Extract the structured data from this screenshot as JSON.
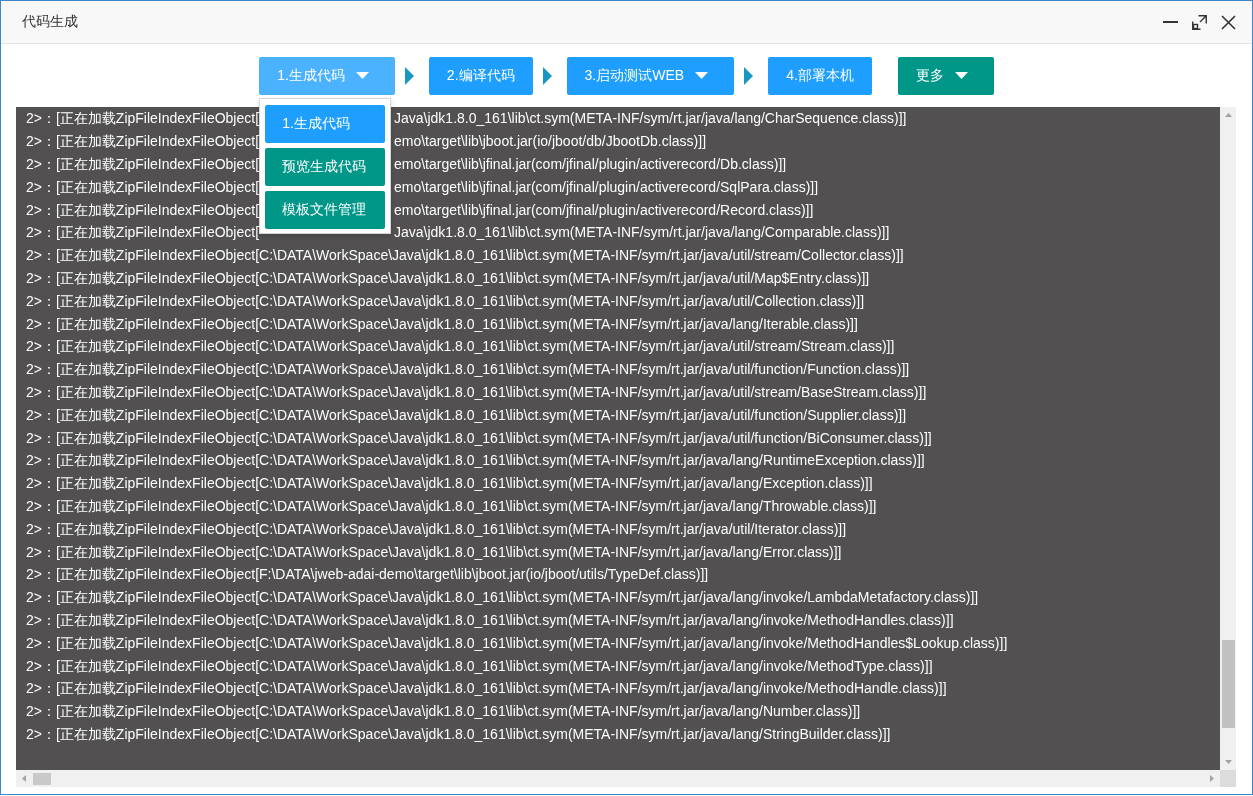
{
  "window": {
    "title": "代码生成"
  },
  "toolbar": [
    {
      "kind": "step",
      "label": "1.生成代码",
      "dropdown": true,
      "expanded": true,
      "menu": [
        {
          "label": "1.生成代码",
          "color": "#1e9fff"
        },
        {
          "label": "预览生成代码",
          "color": "#009688"
        },
        {
          "label": "模板文件管理",
          "color": "#009688"
        }
      ]
    },
    {
      "kind": "step",
      "label": "2.编译代码",
      "dropdown": false,
      "expanded": false
    },
    {
      "kind": "step",
      "label": "3.启动测试WEB",
      "dropdown": true,
      "expanded": false
    },
    {
      "kind": "step",
      "label": "4.部署本机",
      "dropdown": false,
      "expanded": false
    },
    {
      "kind": "more",
      "label": "更多",
      "dropdown": true,
      "expanded": false
    }
  ],
  "log": {
    "lines": [
      {
        "parts": [
          "2>：[正在加载ZipFileIndexFileObject[",
          "Java\\jdk1.8.0_161\\lib\\ct.sym(META-INF/sym/rt.jar/java/lang/CharSequence.class)]]"
        ]
      },
      {
        "parts": [
          "2>：[正在加载ZipFileIndexFileObject[",
          "emo\\target\\lib\\jboot.jar(io/jboot/db/JbootDb.class)]]"
        ]
      },
      {
        "parts": [
          "2>：[正在加载ZipFileIndexFileObject[",
          "emo\\target\\lib\\jfinal.jar(com/jfinal/plugin/activerecord/Db.class)]]"
        ]
      },
      {
        "parts": [
          "2>：[正在加载ZipFileIndexFileObject[",
          "emo\\target\\lib\\jfinal.jar(com/jfinal/plugin/activerecord/SqlPara.class)]]"
        ]
      },
      {
        "parts": [
          "2>：[正在加载ZipFileIndexFileObject[",
          "emo\\target\\lib\\jfinal.jar(com/jfinal/plugin/activerecord/Record.class)]]"
        ]
      },
      {
        "parts": [
          "2>：[正在加载ZipFileIndexFileObject[",
          "Java\\jdk1.8.0_161\\lib\\ct.sym(META-INF/sym/rt.jar/java/lang/Comparable.class)]]"
        ]
      },
      {
        "parts": [
          "2>：[正在加载ZipFileIndexFileObject[C:\\DATA\\WorkSpace\\Java\\jdk1.8.0_161\\lib\\ct.sym(META-INF/sym/rt.jar/java/util/stream/Collector.class)]]"
        ]
      },
      {
        "parts": [
          "2>：[正在加载ZipFileIndexFileObject[C:\\DATA\\WorkSpace\\Java\\jdk1.8.0_161\\lib\\ct.sym(META-INF/sym/rt.jar/java/util/Map$Entry.class)]]"
        ]
      },
      {
        "parts": [
          "2>：[正在加载ZipFileIndexFileObject[C:\\DATA\\WorkSpace\\Java\\jdk1.8.0_161\\lib\\ct.sym(META-INF/sym/rt.jar/java/util/Collection.class)]]"
        ]
      },
      {
        "parts": [
          "2>：[正在加载ZipFileIndexFileObject[C:\\DATA\\WorkSpace\\Java\\jdk1.8.0_161\\lib\\ct.sym(META-INF/sym/rt.jar/java/lang/Iterable.class)]]"
        ]
      },
      {
        "parts": [
          "2>：[正在加载ZipFileIndexFileObject[C:\\DATA\\WorkSpace\\Java\\jdk1.8.0_161\\lib\\ct.sym(META-INF/sym/rt.jar/java/util/stream/Stream.class)]]"
        ]
      },
      {
        "parts": [
          "2>：[正在加载ZipFileIndexFileObject[C:\\DATA\\WorkSpace\\Java\\jdk1.8.0_161\\lib\\ct.sym(META-INF/sym/rt.jar/java/util/function/Function.class)]]"
        ]
      },
      {
        "parts": [
          "2>：[正在加载ZipFileIndexFileObject[C:\\DATA\\WorkSpace\\Java\\jdk1.8.0_161\\lib\\ct.sym(META-INF/sym/rt.jar/java/util/stream/BaseStream.class)]]"
        ]
      },
      {
        "parts": [
          "2>：[正在加载ZipFileIndexFileObject[C:\\DATA\\WorkSpace\\Java\\jdk1.8.0_161\\lib\\ct.sym(META-INF/sym/rt.jar/java/util/function/Supplier.class)]]"
        ]
      },
      {
        "parts": [
          "2>：[正在加载ZipFileIndexFileObject[C:\\DATA\\WorkSpace\\Java\\jdk1.8.0_161\\lib\\ct.sym(META-INF/sym/rt.jar/java/util/function/BiConsumer.class)]]"
        ]
      },
      {
        "parts": [
          "2>：[正在加载ZipFileIndexFileObject[C:\\DATA\\WorkSpace\\Java\\jdk1.8.0_161\\lib\\ct.sym(META-INF/sym/rt.jar/java/lang/RuntimeException.class)]]"
        ]
      },
      {
        "parts": [
          "2>：[正在加载ZipFileIndexFileObject[C:\\DATA\\WorkSpace\\Java\\jdk1.8.0_161\\lib\\ct.sym(META-INF/sym/rt.jar/java/lang/Exception.class)]]"
        ]
      },
      {
        "parts": [
          "2>：[正在加载ZipFileIndexFileObject[C:\\DATA\\WorkSpace\\Java\\jdk1.8.0_161\\lib\\ct.sym(META-INF/sym/rt.jar/java/lang/Throwable.class)]]"
        ]
      },
      {
        "parts": [
          "2>：[正在加载ZipFileIndexFileObject[C:\\DATA\\WorkSpace\\Java\\jdk1.8.0_161\\lib\\ct.sym(META-INF/sym/rt.jar/java/util/Iterator.class)]]"
        ]
      },
      {
        "parts": [
          "2>：[正在加载ZipFileIndexFileObject[C:\\DATA\\WorkSpace\\Java\\jdk1.8.0_161\\lib\\ct.sym(META-INF/sym/rt.jar/java/lang/Error.class)]]"
        ]
      },
      {
        "parts": [
          "2>：[正在加载ZipFileIndexFileObject[F:\\DATA\\jweb-adai-demo\\target\\lib\\jboot.jar(io/jboot/utils/TypeDef.class)]]"
        ]
      },
      {
        "parts": [
          "2>：[正在加载ZipFileIndexFileObject[C:\\DATA\\WorkSpace\\Java\\jdk1.8.0_161\\lib\\ct.sym(META-INF/sym/rt.jar/java/lang/invoke/LambdaMetafactory.class)]]"
        ]
      },
      {
        "parts": [
          "2>：[正在加载ZipFileIndexFileObject[C:\\DATA\\WorkSpace\\Java\\jdk1.8.0_161\\lib\\ct.sym(META-INF/sym/rt.jar/java/lang/invoke/MethodHandles.class)]]"
        ]
      },
      {
        "parts": [
          "2>：[正在加载ZipFileIndexFileObject[C:\\DATA\\WorkSpace\\Java\\jdk1.8.0_161\\lib\\ct.sym(META-INF/sym/rt.jar/java/lang/invoke/MethodHandles$Lookup.class)]]"
        ]
      },
      {
        "parts": [
          "2>：[正在加载ZipFileIndexFileObject[C:\\DATA\\WorkSpace\\Java\\jdk1.8.0_161\\lib\\ct.sym(META-INF/sym/rt.jar/java/lang/invoke/MethodType.class)]]"
        ]
      },
      {
        "parts": [
          "2>：[正在加载ZipFileIndexFileObject[C:\\DATA\\WorkSpace\\Java\\jdk1.8.0_161\\lib\\ct.sym(META-INF/sym/rt.jar/java/lang/invoke/MethodHandle.class)]]"
        ]
      },
      {
        "parts": [
          "2>：[正在加载ZipFileIndexFileObject[C:\\DATA\\WorkSpace\\Java\\jdk1.8.0_161\\lib\\ct.sym(META-INF/sym/rt.jar/java/lang/Number.class)]]"
        ]
      },
      {
        "parts": [
          "2>：[正在加载ZipFileIndexFileObject[C:\\DATA\\WorkSpace\\Java\\jdk1.8.0_161\\lib\\ct.sym(META-INF/sym/rt.jar/java/lang/StringBuilder.class)]]"
        ]
      }
    ]
  }
}
